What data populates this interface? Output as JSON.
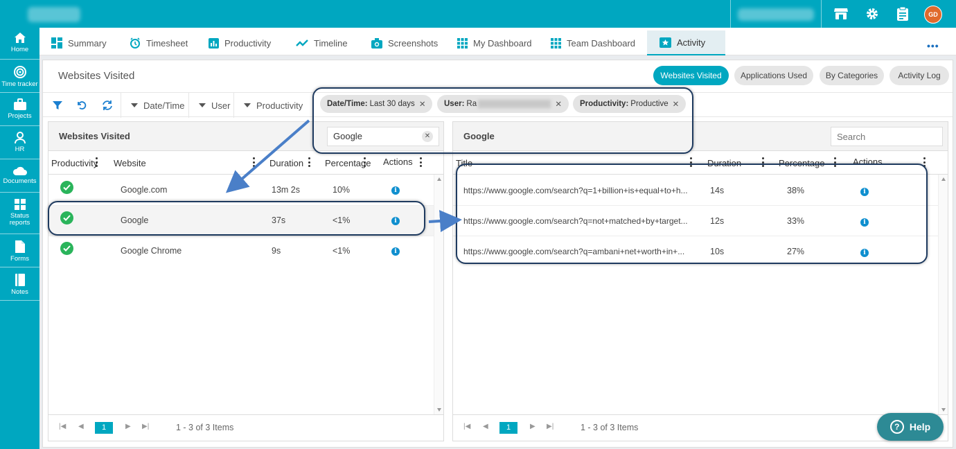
{
  "topbar": {
    "avatar_initials": "GD",
    "accent": "#00a7c0"
  },
  "sidebar": {
    "items": [
      {
        "label": "Home",
        "icon": "home-icon"
      },
      {
        "label": "Time tracker",
        "icon": "time-tracker-icon"
      },
      {
        "label": "Projects",
        "icon": "briefcase-icon"
      },
      {
        "label": "HR",
        "icon": "person-icon"
      },
      {
        "label": "Documents",
        "icon": "cloud-icon"
      },
      {
        "label": "Status reports",
        "icon": "grid-icon"
      },
      {
        "label": "Forms",
        "icon": "file-icon"
      },
      {
        "label": "Notes",
        "icon": "notebook-icon"
      }
    ]
  },
  "tabs": [
    {
      "label": "Summary",
      "icon": "dashboard-icon"
    },
    {
      "label": "Timesheet",
      "icon": "clock-icon"
    },
    {
      "label": "Productivity",
      "icon": "bar-chart-icon"
    },
    {
      "label": "Timeline",
      "icon": "trend-icon"
    },
    {
      "label": "Screenshots",
      "icon": "camera-icon"
    },
    {
      "label": "My Dashboard",
      "icon": "grid-icon"
    },
    {
      "label": "Team Dashboard",
      "icon": "grid-icon"
    },
    {
      "label": "Activity",
      "icon": "star-card-icon",
      "active": true
    }
  ],
  "page": {
    "title": "Websites Visited",
    "views": [
      {
        "label": "Websites Visited",
        "active": true
      },
      {
        "label": "Applications Used"
      },
      {
        "label": "By Categories"
      },
      {
        "label": "Activity Log"
      }
    ]
  },
  "filters": {
    "dropdowns": [
      "Date/Time",
      "User",
      "Productivity"
    ],
    "chips": [
      {
        "key": "Date/Time:",
        "value": "Last 30 days"
      },
      {
        "key": "User:",
        "value": "Ra"
      },
      {
        "key": "Productivity:",
        "value": "Productive"
      }
    ]
  },
  "left_grid": {
    "title": "Websites Visited",
    "search_value": "Google",
    "columns": [
      "Productivity",
      "Website",
      "Duration",
      "Percentage",
      "Actions"
    ],
    "rows": [
      {
        "website": "Google.com",
        "duration": "13m 2s",
        "percentage": "10%"
      },
      {
        "website": "Google",
        "duration": "37s",
        "percentage": "<1%"
      },
      {
        "website": "Google Chrome",
        "duration": "9s",
        "percentage": "<1%"
      }
    ],
    "pager": {
      "page": "1",
      "info": "1 - 3 of 3 Items"
    }
  },
  "right_grid": {
    "title": "Google",
    "search_placeholder": "Search",
    "columns": [
      "Title",
      "Duration",
      "Percentage",
      "Actions"
    ],
    "rows": [
      {
        "title": "https://www.google.com/search?q=1+billion+is+equal+to+h...",
        "duration": "14s",
        "percentage": "38%"
      },
      {
        "title": "https://www.google.com/search?q=not+matched+by+target...",
        "duration": "12s",
        "percentage": "33%"
      },
      {
        "title": "https://www.google.com/search?q=ambani+net+worth+in+...",
        "duration": "10s",
        "percentage": "27%"
      }
    ],
    "pager": {
      "page": "1",
      "info": "1 - 3 of 3 Items"
    }
  },
  "help": {
    "label": "Help"
  }
}
